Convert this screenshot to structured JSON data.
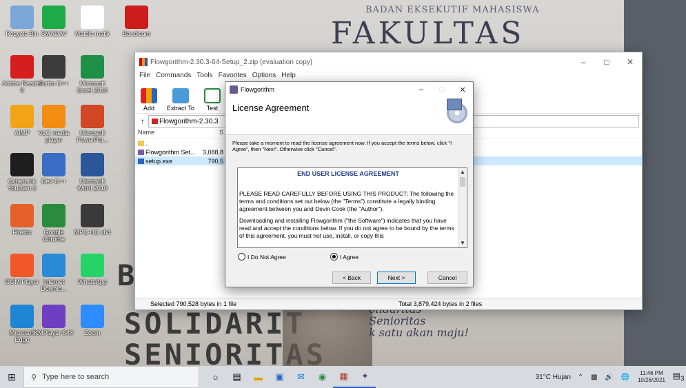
{
  "desktop": {
    "wall": {
      "banner_small": "BADAN EKSEKUTIF MAHASISWA",
      "banner_big": "FAKULTAS TEKNIK",
      "left_b": "B",
      "line1": "SOLIDARIT",
      "line2": "SENIORITAS",
      "script1": "olidaritas",
      "script2": "Senioritas",
      "script3": "k satu akan maju!"
    },
    "icons": [
      {
        "label": "Recycle Bin",
        "icon": "recycle-bin-icon",
        "color": "#7aa7d8"
      },
      {
        "label": "SMADAV",
        "icon": "smadav-icon",
        "color": "#1faa48"
      },
      {
        "label": "Matdis matik",
        "icon": "document-icon",
        "color": "#ffffff"
      },
      {
        "label": "Bandicam",
        "icon": "bandicam-icon",
        "color": "#cc1c1c"
      },
      {
        "label": "Adobe Reader 9",
        "icon": "adobe-reader-icon",
        "color": "#d61e1e"
      },
      {
        "label": "Turbo C++",
        "icon": "turbo-c-icon",
        "color": "#3c3c3c"
      },
      {
        "label": "Microsoft Excel 2010",
        "icon": "excel-icon",
        "color": "#1f8f45"
      },
      {
        "label": "AIMP",
        "icon": "aimp-icon",
        "color": "#f0a416"
      },
      {
        "label": "VLC media player",
        "icon": "vlc-icon",
        "color": "#f28c12"
      },
      {
        "label": "Microsoft PowerPoi...",
        "icon": "powerpoint-icon",
        "color": "#d24726"
      },
      {
        "label": "CyberLink YouCam 5",
        "icon": "youcam-icon",
        "color": "#1e1e1e"
      },
      {
        "label": "Dev-C++",
        "icon": "devcpp-icon",
        "color": "#3a6cc4"
      },
      {
        "label": "Microsoft Word 2010",
        "icon": "word-icon",
        "color": "#2b579a"
      },
      {
        "label": "Firefox",
        "icon": "firefox-icon",
        "color": "#e6602b"
      },
      {
        "label": "Google Chrome",
        "icon": "chrome-icon",
        "color": "#2a8a3e"
      },
      {
        "label": "MPC-HC x64",
        "icon": "mpc-hc-icon",
        "color": "#3a3a3a"
      },
      {
        "label": "GOM Player",
        "icon": "gom-player-icon",
        "color": "#f0582a"
      },
      {
        "label": "Internet Downlo...",
        "icon": "idm-icon",
        "color": "#2a8ad8"
      },
      {
        "label": "WhatsApp",
        "icon": "whatsapp-icon",
        "color": "#25d366"
      },
      {
        "label": "Microsoft Edge",
        "icon": "edge-icon",
        "color": "#1f86d6"
      },
      {
        "label": "KMPlayer 64X",
        "icon": "kmplayer-icon",
        "color": "#6e3fc2"
      },
      {
        "label": "Zoom",
        "icon": "zoom-icon",
        "color": "#2d8cff"
      }
    ]
  },
  "winrar": {
    "title": "Flowgorithm-2.30.3-64-Setup_2.zip (evaluation copy)",
    "menu": [
      "File",
      "Commands",
      "Tools",
      "Favorites",
      "Options",
      "Help"
    ],
    "toolbar": [
      "Add",
      "Extract To",
      "Test"
    ],
    "address": "Flowgorithm-2.30.3",
    "columns": {
      "name": "Name",
      "size": "S"
    },
    "files": [
      {
        "name": "..",
        "size": "",
        "icon": "folder-icon"
      },
      {
        "name": "Flowgorithm Set...",
        "size": "3,088,8",
        "icon": "installer-icon"
      },
      {
        "name": "setup.exe",
        "size": "790,5",
        "icon": "exe-icon"
      }
    ],
    "status_left": "Selected 790,528 bytes in 1 file",
    "status_right": "Total 3,879,424 bytes in 2 files"
  },
  "dialog": {
    "title": "Flowgorithm",
    "header": "License Agreement",
    "intro": "Please take a moment to read the license agreement now. If you accept the terms below, click \"I Agree\", then \"Next\". Otherwise click \"Cancel\".",
    "eula_title": "END USER LICENSE AGREEMENT",
    "eula_p1": "PLEASE READ CAREFULLY BEFORE USING THIS PRODUCT:  The following the terms and conditions set out below (the \"Terms\") constitute a legally binding agreement between you and Devin Cook (the \"Author\").",
    "eula_p2": "Downloading and installing Flowgorithm (\"the Software\") indicates that you have read and accept the conditions below. If you do not agree to be bound by the terms of this agreement, you must not use, install, or copy this",
    "radio_disagree": "I Do Not Agree",
    "radio_agree": "I Agree",
    "agree_selected": true,
    "btn_back": "< Back",
    "btn_next": "Next >",
    "btn_cancel": "Cancel"
  },
  "taskbar": {
    "search_placeholder": "Type here to search",
    "weather": "31°C  Hujan",
    "time": "11:46 PM",
    "date": "10/26/2021",
    "notification_count": "3"
  }
}
